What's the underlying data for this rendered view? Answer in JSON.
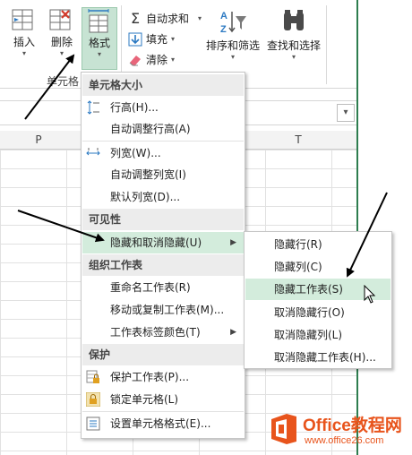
{
  "ribbon": {
    "insert_label": "插入",
    "delete_label": "删除",
    "format_label": "格式",
    "cells_group_label": "单元格",
    "autosum_label": "自动求和",
    "fill_label": "填充",
    "clear_label": "清除",
    "sort_filter_label": "排序和筛选",
    "find_select_label": "查找和选择"
  },
  "columns": [
    "P",
    "T"
  ],
  "format_menu": {
    "cell_size_header": "单元格大小",
    "row_height": "行高(H)...",
    "autofit_row_height": "自动调整行高(A)",
    "column_width": "列宽(W)...",
    "autofit_column_width": "自动调整列宽(I)",
    "default_width": "默认列宽(D)...",
    "visibility_header": "可见性",
    "hide_unhide": "隐藏和取消隐藏(U)",
    "organize_sheets_header": "组织工作表",
    "rename_sheet": "重命名工作表(R)",
    "move_copy_sheet": "移动或复制工作表(M)...",
    "tab_color": "工作表标签颜色(T)",
    "protection_header": "保护",
    "protect_sheet": "保护工作表(P)...",
    "lock_cell": "锁定单元格(L)",
    "format_cells": "设置单元格格式(E)..."
  },
  "hide_submenu": {
    "hide_rows": "隐藏行(R)",
    "hide_columns": "隐藏列(C)",
    "hide_sheet": "隐藏工作表(S)",
    "unhide_rows": "取消隐藏行(O)",
    "unhide_columns": "取消隐藏列(L)",
    "unhide_sheet": "取消隐藏工作表(H)..."
  },
  "logo": {
    "brand": "Office教程网",
    "url": "www.office26.com"
  },
  "colors": {
    "accent_green": "#217346",
    "highlight": "#d3ecdc",
    "logo_orange": "#e8541c"
  }
}
